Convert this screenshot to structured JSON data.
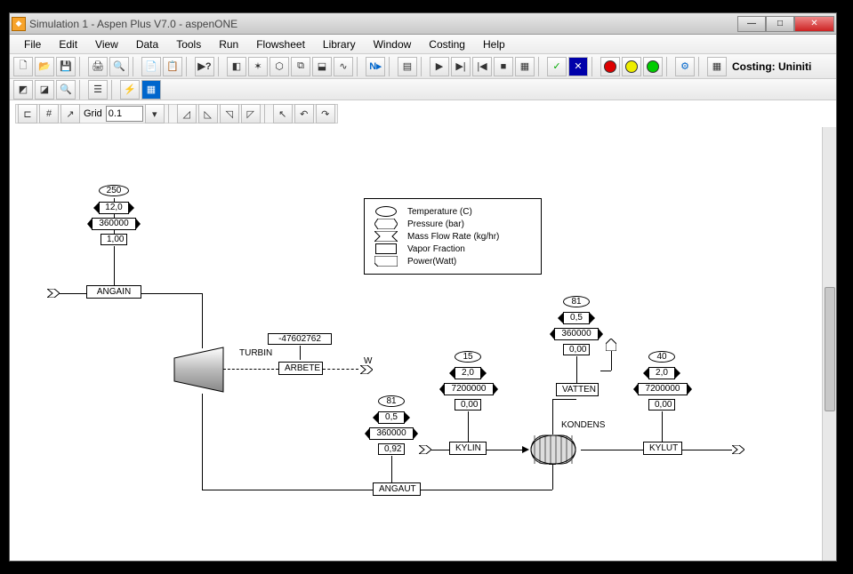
{
  "window": {
    "title": "Simulation 1 - Aspen Plus V7.0 - aspenONE"
  },
  "menu": [
    "File",
    "Edit",
    "View",
    "Data",
    "Tools",
    "Run",
    "Flowsheet",
    "Library",
    "Window",
    "Costing",
    "Help"
  ],
  "costing_status": "Costing: Uniniti",
  "grid": {
    "label": "Grid",
    "value": "0.1"
  },
  "legend": {
    "temperature": "Temperature (C)",
    "pressure": "Pressure (bar)",
    "massflow": "Mass Flow Rate (kg/hr)",
    "vaporfrac": "Vapor Fraction",
    "power": "Power(Watt)"
  },
  "streams": {
    "angain": {
      "name": "ANGAIN",
      "T": "250",
      "P": "12,0",
      "F": "360000",
      "VF": "1,00"
    },
    "angaut": {
      "name": "ANGAUT",
      "T": "81",
      "P": "0,5",
      "F": "360000",
      "VF": "0,92"
    },
    "kylin": {
      "name": "KYLIN",
      "T": "15",
      "P": "2,0",
      "F": "7200000",
      "VF": "0,00"
    },
    "kylut": {
      "name": "KYLUT",
      "T": "40",
      "P": "2,0",
      "F": "7200000",
      "VF": "0,00"
    },
    "vatten": {
      "name": "VATTEN",
      "T": "81",
      "P": "0,5",
      "F": "360000",
      "VF": "0,00"
    },
    "arbete": {
      "name": "ARBETE",
      "power": "-47602762",
      "w_label": "W"
    }
  },
  "blocks": {
    "turbin": "TURBIN",
    "kondens": "KONDENS"
  }
}
